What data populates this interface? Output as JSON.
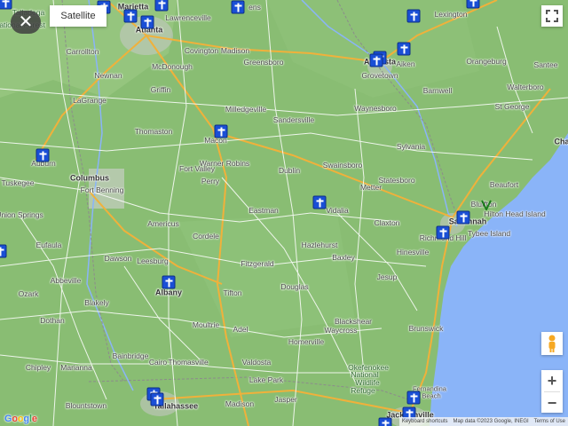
{
  "controls": {
    "close_label": "✕",
    "satellite_label": "Satellite",
    "zoom_in": "+",
    "zoom_out": "−"
  },
  "attribution": {
    "keyboard": "Keyboard shortcuts",
    "map_data": "Map data ©2023 Google, INEGI",
    "terms": "Terms of Use"
  },
  "logo": "Google",
  "places": [
    {
      "name": "Marietta",
      "style": "big"
    },
    {
      "name": "Atlanta",
      "style": "big"
    },
    {
      "name": "Lawrenceville",
      "style": ""
    },
    {
      "name": "ens",
      "style": ""
    },
    {
      "name": "Lexington",
      "style": ""
    },
    {
      "name": "Carrollton",
      "style": ""
    },
    {
      "name": "Covington",
      "style": ""
    },
    {
      "name": "Madison",
      "style": ""
    },
    {
      "name": "Greensboro",
      "style": ""
    },
    {
      "name": "Augusta",
      "style": "big"
    },
    {
      "name": "Aiken",
      "style": ""
    },
    {
      "name": "Orangeburg",
      "style": ""
    },
    {
      "name": "Santee",
      "style": ""
    },
    {
      "name": "McDonough",
      "style": ""
    },
    {
      "name": "Newnan",
      "style": ""
    },
    {
      "name": "Grovetown",
      "style": ""
    },
    {
      "name": "Barnwell",
      "style": ""
    },
    {
      "name": "Griffin",
      "style": ""
    },
    {
      "name": "Milledgeville",
      "style": ""
    },
    {
      "name": "Waynesboro",
      "style": ""
    },
    {
      "name": "Walterboro",
      "style": ""
    },
    {
      "name": "St George",
      "style": ""
    },
    {
      "name": "LaGrange",
      "style": ""
    },
    {
      "name": "Sandersville",
      "style": ""
    },
    {
      "name": "Thomaston",
      "style": ""
    },
    {
      "name": "Macon",
      "style": ""
    },
    {
      "name": "Sylvania",
      "style": ""
    },
    {
      "name": "Cha",
      "style": "big"
    },
    {
      "name": "Auburn",
      "style": ""
    },
    {
      "name": "Warner Robins",
      "style": ""
    },
    {
      "name": "Fort Valley",
      "style": ""
    },
    {
      "name": "Dublin",
      "style": ""
    },
    {
      "name": "Swainsboro",
      "style": ""
    },
    {
      "name": "Statesboro",
      "style": ""
    },
    {
      "name": "Beaufort",
      "style": ""
    },
    {
      "name": "Tuskegee",
      "style": ""
    },
    {
      "name": "Columbus",
      "style": "big"
    },
    {
      "name": "Fort Benning",
      "style": ""
    },
    {
      "name": "Perry",
      "style": ""
    },
    {
      "name": "Metter",
      "style": ""
    },
    {
      "name": "Bluffton",
      "style": ""
    },
    {
      "name": "Hilton Head Island",
      "style": ""
    },
    {
      "name": "Union Springs",
      "style": ""
    },
    {
      "name": "Eastman",
      "style": ""
    },
    {
      "name": "Vidalia",
      "style": ""
    },
    {
      "name": "Claxton",
      "style": ""
    },
    {
      "name": "Savannah",
      "style": "big"
    },
    {
      "name": "Tybee Island",
      "style": ""
    },
    {
      "name": "Americus",
      "style": ""
    },
    {
      "name": "Cordele",
      "style": ""
    },
    {
      "name": "Richmond Hill",
      "style": ""
    },
    {
      "name": "Eufaula",
      "style": ""
    },
    {
      "name": "Hazlehurst",
      "style": ""
    },
    {
      "name": "Dawson",
      "style": ""
    },
    {
      "name": "Leesburg",
      "style": ""
    },
    {
      "name": "Baxley",
      "style": ""
    },
    {
      "name": "Hinesville",
      "style": ""
    },
    {
      "name": "Fitzgerald",
      "style": ""
    },
    {
      "name": "Abbeville",
      "style": ""
    },
    {
      "name": "Albany",
      "style": "big"
    },
    {
      "name": "Douglas",
      "style": ""
    },
    {
      "name": "Jesup",
      "style": ""
    },
    {
      "name": "Ozark",
      "style": ""
    },
    {
      "name": "Tifton",
      "style": ""
    },
    {
      "name": "Blakely",
      "style": ""
    },
    {
      "name": "Dothan",
      "style": ""
    },
    {
      "name": "Blackshear",
      "style": ""
    },
    {
      "name": "Moultrie",
      "style": ""
    },
    {
      "name": "Adel",
      "style": ""
    },
    {
      "name": "Waycross",
      "style": ""
    },
    {
      "name": "Brunswick",
      "style": ""
    },
    {
      "name": "Homerville",
      "style": ""
    },
    {
      "name": "Bainbridge",
      "style": ""
    },
    {
      "name": "Cairo",
      "style": ""
    },
    {
      "name": "Thomasville",
      "style": ""
    },
    {
      "name": "Valdosta",
      "style": ""
    },
    {
      "name": "Chipley",
      "style": ""
    },
    {
      "name": "Marianna",
      "style": ""
    },
    {
      "name": "Lake Park",
      "style": ""
    },
    {
      "name": "Okefenokee",
      "style": "green"
    },
    {
      "name": "National",
      "style": "green"
    },
    {
      "name": "Wildlife",
      "style": "green"
    },
    {
      "name": "Refuge",
      "style": "green"
    },
    {
      "name": "Fernandina",
      "style": "small"
    },
    {
      "name": "Beach",
      "style": "small"
    },
    {
      "name": "Blountstown",
      "style": ""
    },
    {
      "name": "Tallahassee",
      "style": "big"
    },
    {
      "name": "Madison",
      "style": ""
    },
    {
      "name": "Jasper",
      "style": ""
    },
    {
      "name": "Jacksonville",
      "style": "big"
    },
    {
      "name": "Talladega",
      "style": "green"
    },
    {
      "name": "National Forest",
      "style": "green"
    }
  ],
  "pins_count": 23
}
